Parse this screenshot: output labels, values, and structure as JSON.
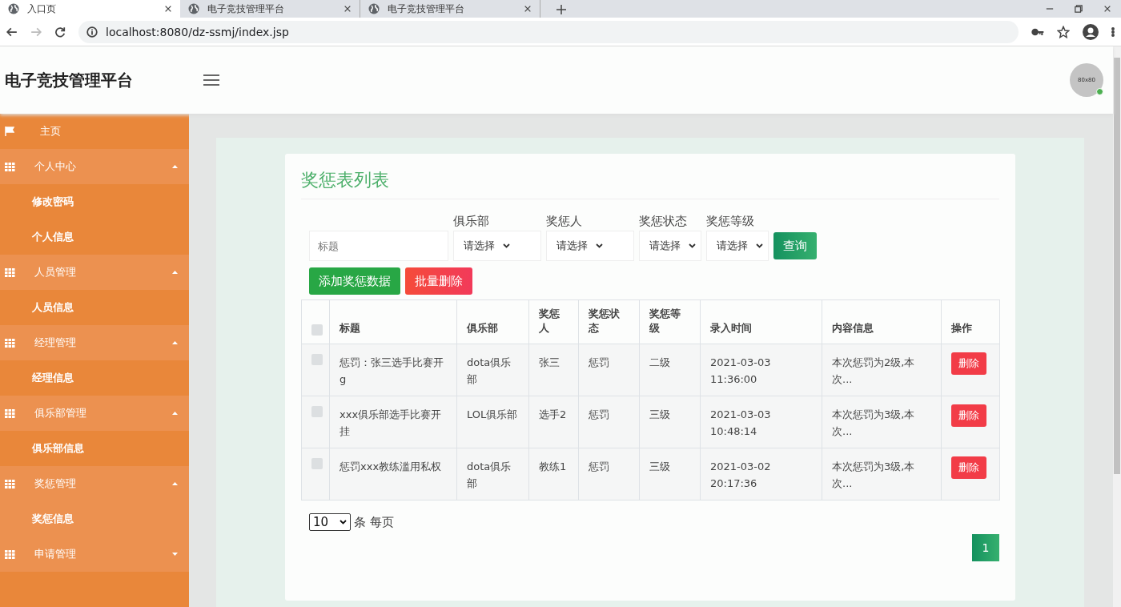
{
  "browser": {
    "tabs": [
      {
        "label": "入口页",
        "selected": true
      },
      {
        "label": "电子竞技管理平台",
        "selected": false
      },
      {
        "label": "电子竞技管理平台",
        "selected": false
      }
    ],
    "url": "localhost:8080/dz-ssmj/index.jsp"
  },
  "header": {
    "title": "电子竞技管理平台",
    "avatar_text": "80x80",
    "online": true
  },
  "sidebar": {
    "items": [
      {
        "kind": "link",
        "label": "主页"
      },
      {
        "kind": "group",
        "label": "个人中心",
        "expanded": true,
        "children": [
          {
            "label": "修改密码",
            "selected": false
          },
          {
            "label": "个人信息",
            "selected": false
          }
        ]
      },
      {
        "kind": "group",
        "label": "人员管理",
        "expanded": true,
        "children": [
          {
            "label": "人员信息",
            "selected": false
          }
        ]
      },
      {
        "kind": "group",
        "label": "经理管理",
        "expanded": true,
        "children": [
          {
            "label": "经理信息",
            "selected": false
          }
        ]
      },
      {
        "kind": "group",
        "label": "俱乐部管理",
        "expanded": true,
        "children": [
          {
            "label": "俱乐部信息",
            "selected": false
          }
        ]
      },
      {
        "kind": "group",
        "label": "奖惩管理",
        "expanded": true,
        "children": [
          {
            "label": "奖惩信息",
            "selected": true
          }
        ]
      },
      {
        "kind": "group",
        "label": "申请管理",
        "expanded": false
      }
    ]
  },
  "content": {
    "title": "奖惩表列表",
    "filters": [
      {
        "kind": "text",
        "placeholder": "标题"
      },
      {
        "kind": "select",
        "label": "俱乐部",
        "value": "请选择"
      },
      {
        "kind": "select",
        "label": "奖惩人",
        "value": "请选择"
      },
      {
        "kind": "select",
        "label": "奖惩状态",
        "value": "请选择"
      },
      {
        "kind": "select",
        "label": "奖惩等级",
        "value": "请选择"
      }
    ],
    "search_button": "查询",
    "actions": [
      {
        "kind": "add",
        "label": "添加奖惩数据"
      },
      {
        "kind": "delete",
        "label": "批量删除"
      }
    ],
    "table": {
      "header_checked": false,
      "columns": [
        "标题",
        "俱乐部",
        "奖惩人",
        "奖惩状态",
        "奖惩等级",
        "录入时间",
        "内容信息",
        "操作"
      ],
      "rows": [
        {
          "checked": false,
          "cells": [
            "惩罚：张三选手比赛开g",
            "dota俱乐部",
            "张三",
            "惩罚",
            "二级",
            "2021-03-03 11:36:00",
            "本次惩罚为2级,本次..."
          ],
          "action": "删除"
        },
        {
          "checked": false,
          "cells": [
            "xxx俱乐部选手比赛开挂",
            "LOL俱乐部",
            "选手2",
            "惩罚",
            "三级",
            "2021-03-03 10:48:14",
            "本次惩罚为3级,本次..."
          ],
          "action": "删除"
        },
        {
          "checked": false,
          "cells": [
            "惩罚xxx教练滥用私权",
            "dota俱乐部",
            "教练1",
            "惩罚",
            "三级",
            "2021-03-02 20:17:36",
            "本次惩罚为3级,本次..."
          ],
          "action": "删除"
        }
      ]
    },
    "page_size": "10",
    "page_size_label": "条 每页",
    "pages": [
      {
        "label": "1",
        "selected": true
      }
    ]
  }
}
